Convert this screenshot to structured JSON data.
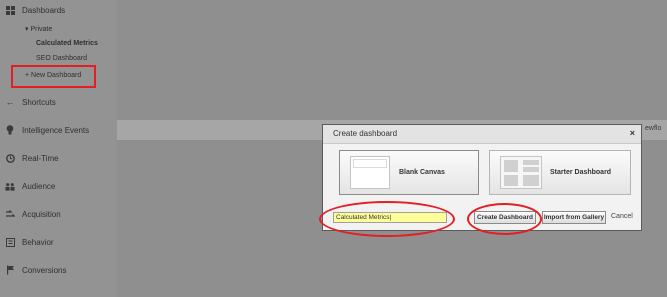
{
  "sidebar": {
    "dashboards": {
      "label": "Dashboards",
      "icon": "grid-icon"
    },
    "private": {
      "label": "▾ Private"
    },
    "sub_items": [
      {
        "label": "Calculated Metrics",
        "bold": true
      },
      {
        "label": "SEO Dashboard",
        "bold": false
      }
    ],
    "new_dashboard": {
      "label": "+ New Dashboard"
    },
    "items": [
      {
        "label": "Shortcuts",
        "icon": "shortcut-arrow-icon"
      },
      {
        "label": "Intelligence Events",
        "icon": "lightbulb-icon"
      },
      {
        "label": "Real-Time",
        "icon": "clock-icon"
      },
      {
        "label": "Audience",
        "icon": "people-icon"
      },
      {
        "label": "Acquisition",
        "icon": "acquisition-icon"
      },
      {
        "label": "Behavior",
        "icon": "behavior-icon"
      },
      {
        "label": "Conversions",
        "icon": "flag-icon"
      }
    ]
  },
  "band": {
    "text": "ewflo"
  },
  "dialog": {
    "title": "Create dashboard",
    "close_label": "×",
    "templates": [
      {
        "label": "Blank Canvas",
        "selected": true
      },
      {
        "label": "Starter Dashboard",
        "selected": false
      }
    ],
    "name_value": "Calculated Metrics|",
    "create_label": "Create Dashboard",
    "import_label": "Import from Gallery",
    "cancel_label": "Cancel"
  },
  "colors": {
    "highlight": "#e31e24",
    "input_bg": "#ffff99"
  }
}
